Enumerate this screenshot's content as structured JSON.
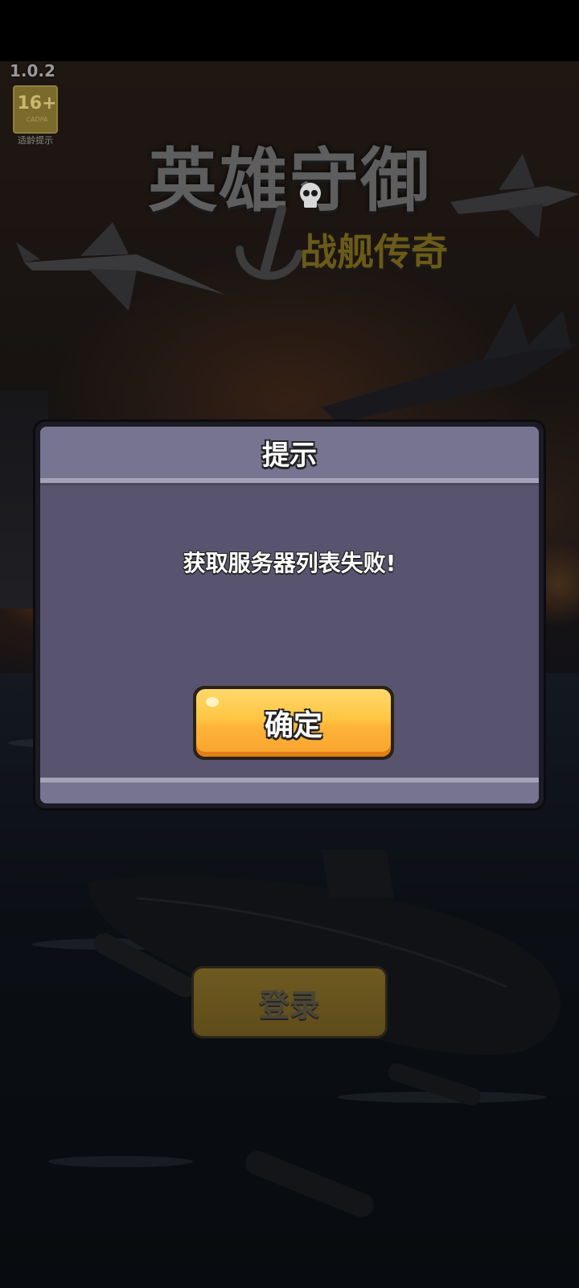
{
  "app": {
    "version": "1.0.2"
  },
  "age_rating": {
    "value": "16+",
    "small_text": "CADPA",
    "caption": "适龄提示"
  },
  "logo": {
    "title": "英雄守御",
    "subtitle": "战舰传奇"
  },
  "login": {
    "label": "登录"
  },
  "dialog": {
    "title": "提示",
    "message": "获取服务器列表失败!",
    "confirm_label": "确定"
  },
  "colors": {
    "dialog_header": "#767491",
    "dialog_body": "#58546f",
    "confirm_button": "#ffc543",
    "login_button": "#5e4c1a"
  },
  "icons": [
    "age-rating-icon",
    "skull-icon",
    "anchor-icon"
  ]
}
